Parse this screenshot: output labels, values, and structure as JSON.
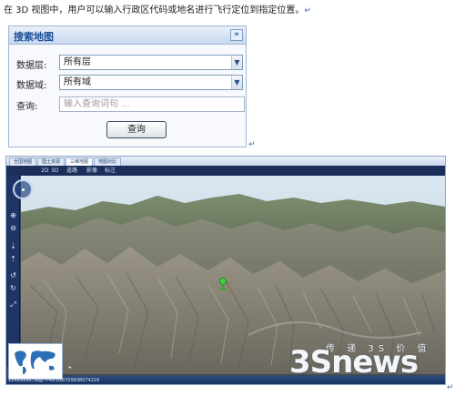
{
  "intro": {
    "text": "在 3D 视图中，用户可以输入行政区代码或地名进行飞行定位到指定位置。",
    "return_mark": "↵"
  },
  "search_panel": {
    "title": "搜索地图",
    "collapse_label": "»",
    "layer_label": "数据层:",
    "layer_value": "所有层",
    "domain_label": "数据域:",
    "domain_value": "所有域",
    "query_label": "查询:",
    "query_placeholder": "输入查询词句 ...",
    "query_button": "查询"
  },
  "viewer": {
    "tabs": [
      "全国地图",
      "国土资源",
      "三维地图",
      "地图对比"
    ],
    "active_tab": "三维地图",
    "toolbar": [
      "2D",
      "3D",
      "道路",
      "影像",
      "标注"
    ],
    "coordinates": "12499998, 纬度->49.618709938074216",
    "sidebar_icons": [
      "zoom-in",
      "zoom-out",
      "tilt-down",
      "tilt-up",
      "rotate-left",
      "rotate-right",
      "zoom-extent"
    ]
  },
  "watermark": {
    "small": "传 递 3S 价 值",
    "big": "3Snews"
  },
  "colors": {
    "brand_blue": "#1c4f9a",
    "viewer_bar": "#1b2f5a",
    "pin_green": "#3fd13f"
  }
}
